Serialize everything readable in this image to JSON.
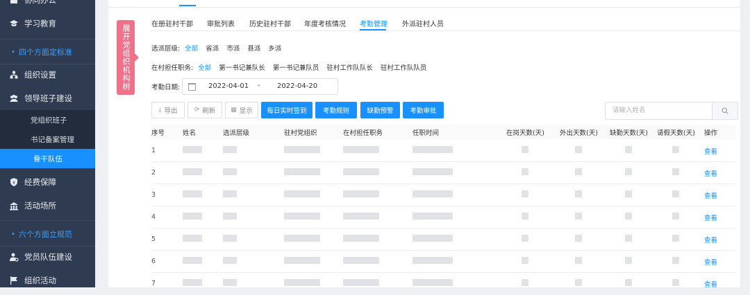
{
  "sidebar": {
    "items": [
      {
        "label": "协同办公",
        "type": "item",
        "icon": "office-icon"
      },
      {
        "label": "学习教育",
        "type": "item",
        "icon": "graduation-cap-icon"
      },
      {
        "label": "四个方面定标准",
        "type": "section"
      },
      {
        "label": "组织设置",
        "type": "item",
        "icon": "org-tree-icon"
      },
      {
        "label": "领导班子建设",
        "type": "item",
        "icon": "people-group-icon"
      },
      {
        "label": "党组织班子",
        "type": "sub"
      },
      {
        "label": "书记备案管理",
        "type": "sub"
      },
      {
        "label": "骨干队伍",
        "type": "sub",
        "active": true
      },
      {
        "label": "经费保障",
        "type": "item",
        "icon": "shield-icon"
      },
      {
        "label": "活动场所",
        "type": "item",
        "icon": "building-icon"
      },
      {
        "label": "六个方面立规范",
        "type": "section"
      },
      {
        "label": "党员队伍建设",
        "type": "item",
        "icon": "user-gear-icon"
      },
      {
        "label": "组织活动",
        "type": "item",
        "icon": "flag-icon"
      }
    ]
  },
  "side_flag": "展开党组织机构树",
  "tabs": [
    {
      "label": "在册驻村干部"
    },
    {
      "label": "审批列表"
    },
    {
      "label": "历史驻村干部"
    },
    {
      "label": "年度考核情况"
    },
    {
      "label": "考勤管理",
      "active": true
    },
    {
      "label": "外派驻村人员"
    }
  ],
  "filters": {
    "level": {
      "label": "选派层级:",
      "options": [
        "全部",
        "省派",
        "市派",
        "县派",
        "乡派"
      ],
      "selected": "全部"
    },
    "position": {
      "label": "在村担任职务:",
      "options": [
        "全部",
        "第一书记兼队长",
        "第一书记兼队员",
        "驻村工作队队长",
        "驻村工作队队员"
      ],
      "selected": "全部"
    },
    "date": {
      "label": "考勤日期:",
      "start": "2022-04-01",
      "sep": "-",
      "end": "2022-04-20"
    }
  },
  "toolbar": {
    "export_label": "导出",
    "refresh_label": "刷新",
    "display_label": "显示",
    "checkin_label": "每日实时签到",
    "rules_label": "考勤规则",
    "warning_label": "缺勤预警",
    "approve_label": "考勤审批"
  },
  "search": {
    "placeholder": "请输入姓名",
    "value": ""
  },
  "table": {
    "columns": [
      "序号",
      "姓名",
      "选派层级",
      "驻村党组织",
      "在村担任职务",
      "任职时间",
      "在岗天数(天)",
      "外出天数(天)",
      "缺勤天数(天)",
      "请假天数(天)",
      "操作"
    ],
    "rows": [
      {
        "no": "1",
        "action": "查看"
      },
      {
        "no": "2",
        "action": "查看"
      },
      {
        "no": "3",
        "action": "查看"
      },
      {
        "no": "4",
        "action": "查看"
      },
      {
        "no": "5",
        "action": "查看"
      },
      {
        "no": "6",
        "action": "查看"
      },
      {
        "no": "7",
        "action": "查看"
      }
    ]
  },
  "colors": {
    "accent": "#1890ff",
    "sidebar_bg": "#2f3b50",
    "flag": "#f0728a"
  }
}
